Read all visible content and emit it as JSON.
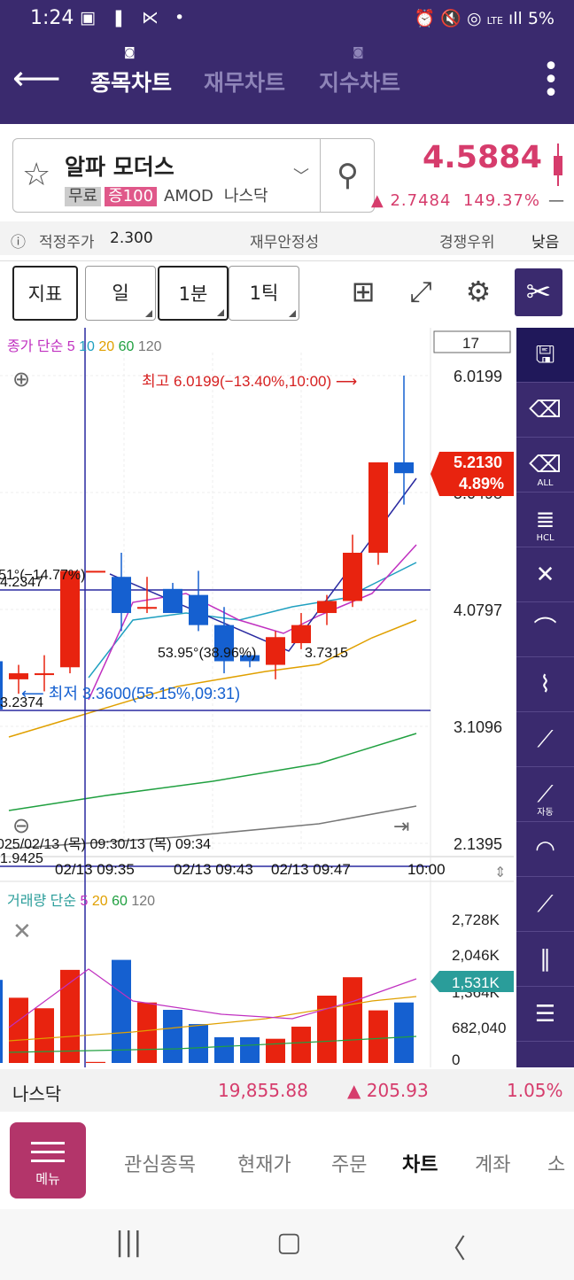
{
  "status_bar": {
    "time": "1:24",
    "left_icons": "▣ ❚ ⋉ •",
    "lte": "LTE",
    "battery": "5%"
  },
  "app_bar": {
    "tabs": [
      {
        "label": "종목차트",
        "active": true
      },
      {
        "label": "재무차트",
        "active": false
      },
      {
        "label": "지수차트",
        "active": false
      }
    ]
  },
  "stock": {
    "name": "알파 모더스",
    "tags": [
      "무료",
      "증100"
    ],
    "ticker": "AMOD",
    "market": "나스닥",
    "price": "4.5884",
    "change": "▲ 2.7484",
    "change_pct": "149.37%",
    "dash": "—"
  },
  "info_row": {
    "fair_price_label": "적정주가",
    "fair_price": "2.300",
    "financial_stability": "재무안정성",
    "competition": "경쟁우위",
    "level": "낮음"
  },
  "toolbar": {
    "indicator": "지표",
    "periods": [
      "일",
      "1분",
      "1틱"
    ],
    "selected_period": "1분"
  },
  "price_chart": {
    "legend": {
      "label": "종가 단순",
      "periods": [
        "5",
        "10",
        "20",
        "60",
        "120"
      ],
      "colors": [
        "#c030c0",
        "#20a0c0",
        "#e0a000",
        "#20a040",
        "#777777"
      ]
    },
    "count_box": "17",
    "y_ticks": [
      "6.0199",
      "5.0498",
      "4.0797",
      "3.1096",
      "2.1395"
    ],
    "high_label": "최고 6.0199(−13.40%,10:00) ⟶",
    "low_label": "⟵ 최저 3.3600(55.15%,09:31)",
    "current_price": "5.2130",
    "current_pct": "4.89%",
    "annotations": {
      "angle_left": "51°(−14.77%)",
      "level_left": "4.2347",
      "angle_mid": "53.95°(38.96%)",
      "level_mid": "3.7315",
      "low_left": "3.2374",
      "bottom_left": "1.9425"
    },
    "date_top": "025/02/13 (목) 09:30/13 (목) 09:34",
    "x_labels": [
      "02/13 09:35",
      "02/13 09:43",
      "02/13 09:47",
      "10:00"
    ],
    "candles": [
      {
        "o": 3.65,
        "h": 3.65,
        "l": 3.2,
        "c": 3.25
      },
      {
        "o": 3.5,
        "h": 3.62,
        "l": 3.38,
        "c": 3.55
      },
      {
        "o": 3.55,
        "h": 3.7,
        "l": 3.4,
        "c": 3.55
      },
      {
        "o": 3.6,
        "h": 4.4,
        "l": 3.55,
        "c": 4.4
      },
      {
        "o": 4.4,
        "h": 4.4,
        "l": 4.4,
        "c": 4.4
      },
      {
        "o": 4.35,
        "h": 4.55,
        "l": 3.9,
        "c": 4.05
      },
      {
        "o": 4.1,
        "h": 4.35,
        "l": 4.05,
        "c": 4.1
      },
      {
        "o": 4.25,
        "h": 4.3,
        "l": 4.05,
        "c": 4.05
      },
      {
        "o": 4.2,
        "h": 4.4,
        "l": 3.9,
        "c": 3.95
      },
      {
        "o": 3.95,
        "h": 4.1,
        "l": 3.55,
        "c": 3.65
      },
      {
        "o": 3.7,
        "h": 3.7,
        "l": 3.6,
        "c": 3.65
      },
      {
        "o": 3.62,
        "h": 3.9,
        "l": 3.5,
        "c": 3.85
      },
      {
        "o": 3.8,
        "h": 4.05,
        "l": 3.75,
        "c": 3.95
      },
      {
        "o": 4.05,
        "h": 4.2,
        "l": 3.95,
        "c": 4.15
      },
      {
        "o": 4.15,
        "h": 4.7,
        "l": 4.1,
        "c": 4.55
      },
      {
        "o": 4.55,
        "h": 5.3,
        "l": 4.45,
        "c": 5.3
      },
      {
        "o": 5.3,
        "h": 6.02,
        "l": 4.95,
        "c": 5.21
      }
    ]
  },
  "volume_chart": {
    "legend": {
      "label": "거래량 단순",
      "periods": [
        "5",
        "20",
        "60",
        "120"
      ],
      "colors": [
        "#c030c0",
        "#e0a000",
        "#20a040",
        "#777777"
      ]
    },
    "y_ticks": [
      "2,728K",
      "2,046K",
      "1,364K",
      "682,040",
      "0"
    ],
    "current_volume": "1,531K",
    "bars": [
      1580,
      1240,
      1040,
      1770,
      20,
      1960,
      1150,
      1010,
      740,
      490,
      490,
      460,
      690,
      1280,
      1630,
      1000,
      1150
    ]
  },
  "sidebar_labels": {
    "auto": "자동",
    "all": "ALL",
    "hcl": "HCL"
  },
  "index_row": {
    "name": "나스닥",
    "value": "19,855.88",
    "change": "▲ 205.93",
    "pct": "1.05%"
  },
  "bottom_nav": {
    "menu": "메뉴",
    "items": [
      "관심종목",
      "현재가",
      "주문",
      "차트",
      "계좌",
      "소"
    ],
    "active": "차트"
  },
  "colors": {
    "brand": "#3a2a6e",
    "up": "#e8230f",
    "down": "#1560d0",
    "price_red": "#d63c6c",
    "volume_tag": "#2a9d9a"
  }
}
